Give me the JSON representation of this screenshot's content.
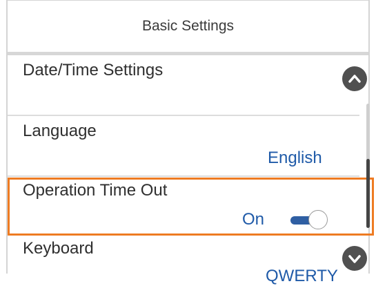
{
  "header": {
    "title": "Basic Settings"
  },
  "items": [
    {
      "label": "Date/Time Settings",
      "value": ""
    },
    {
      "label": "Language",
      "value": "English"
    },
    {
      "label": "Operation Time Out",
      "value": "On",
      "toggle_on": true
    },
    {
      "label": "Keyboard",
      "value": "QWERTY"
    }
  ],
  "scroll": {
    "up_icon": "chevron-up-icon",
    "down_icon": "chevron-down-icon"
  },
  "colors": {
    "highlight": "#ee7b22",
    "value_text": "#1f5aa8",
    "toggle_track": "#2f5fa3",
    "scroll_button": "#505050"
  }
}
